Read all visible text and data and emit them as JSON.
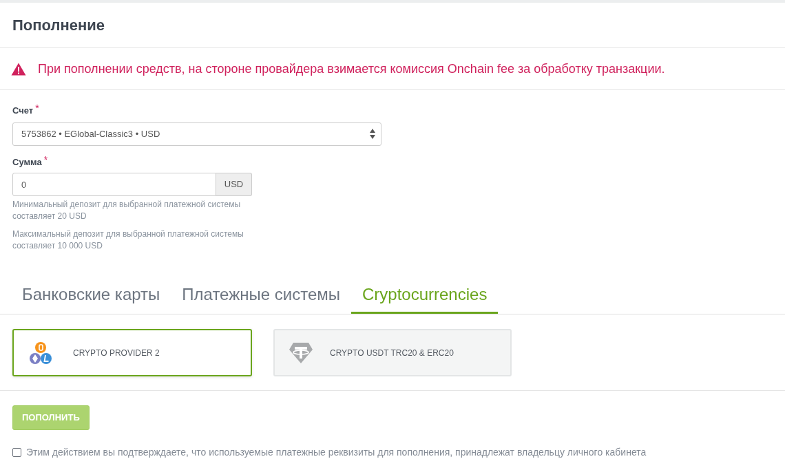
{
  "page": {
    "title": "Пополнение"
  },
  "alert": {
    "text": "При пополнении средств, на стороне провайдера взимается комиссия Onchain fee за обработку транзакции."
  },
  "form": {
    "account": {
      "label": "Счет",
      "required_mark": "*",
      "value": "5753862 • EGlobal-Classic3 • USD"
    },
    "amount": {
      "label": "Сумма",
      "required_mark": "*",
      "value": "0",
      "addon": "USD",
      "hints": [
        "Минимальный депозит для выбранной платежной системы составляет 20 USD",
        "Максимальный депозит для выбранной платежной системы составляет 10 000 USD"
      ]
    }
  },
  "tabs": [
    {
      "label": "Банковские карты",
      "selected": false
    },
    {
      "label": "Платежные системы",
      "selected": false
    },
    {
      "label": "Cryptocurrencies",
      "selected": true
    }
  ],
  "providers": [
    {
      "name": "CRYPTO PROVIDER 2",
      "kind": "multicoin",
      "selected": true
    },
    {
      "name": "CRYPTO USDT TRC20 & ERC20",
      "kind": "tether",
      "selected": false
    }
  ],
  "submit": {
    "label": "ПОПОЛНИТЬ",
    "disabled": true
  },
  "consent": {
    "text": "Этим действием вы подтверждаете, что используемые платежные реквизиты для пополнения, принадлежат владельцу личного кабинета",
    "checked": false
  }
}
